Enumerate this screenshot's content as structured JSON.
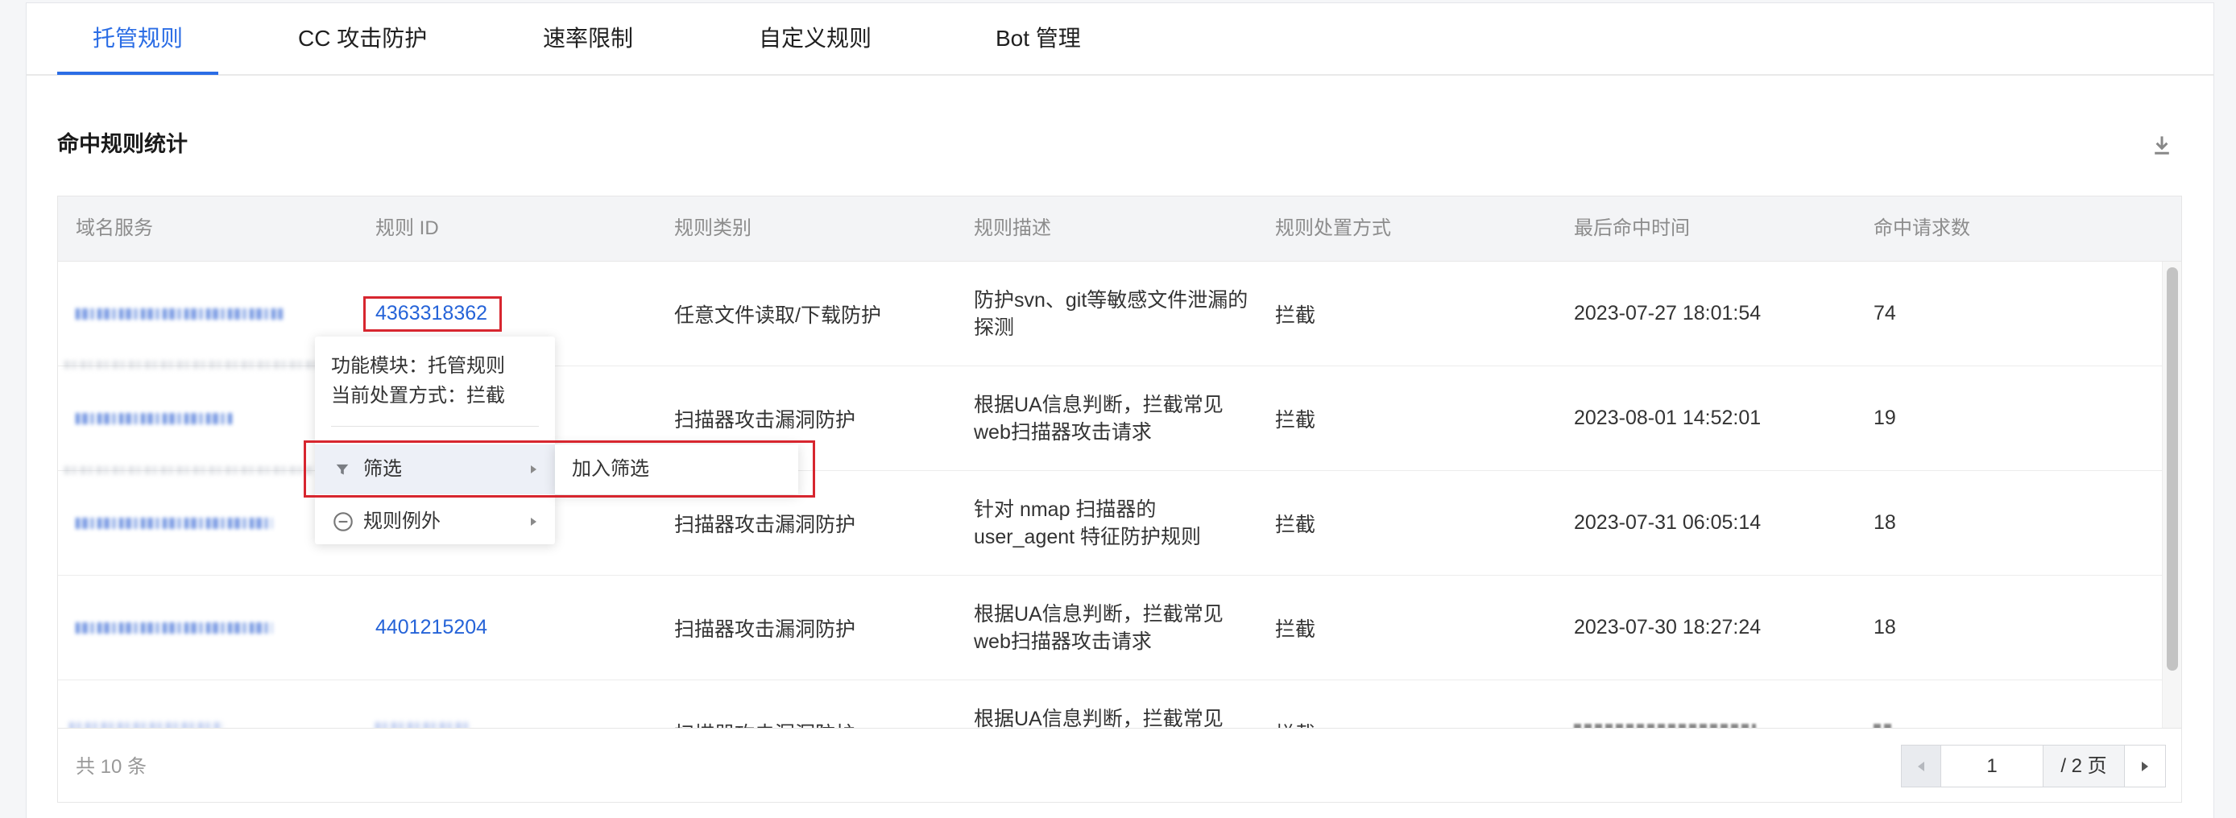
{
  "tabs": [
    {
      "label": "托管规则",
      "active": true
    },
    {
      "label": "CC 攻击防护",
      "active": false
    },
    {
      "label": "速率限制",
      "active": false
    },
    {
      "label": "自定义规则",
      "active": false
    },
    {
      "label": "Bot 管理",
      "active": false
    }
  ],
  "section": {
    "title": "命中规则统计"
  },
  "table": {
    "columns": [
      "域名服务",
      "规则 ID",
      "规则类别",
      "规则描述",
      "规则处置方式",
      "最后命中时间",
      "命中请求数"
    ],
    "rows": [
      {
        "rule_id": "4363318362",
        "category": "任意文件读取/下载防护",
        "description": [
          "防护svn、git等敏感文件泄漏的",
          "探测"
        ],
        "action": "拦截",
        "last_hit": "2023-07-27 18:01:54",
        "hits": "74"
      },
      {
        "category": "扫描器攻击漏洞防护",
        "description": [
          "根据UA信息判断，拦截常见",
          "web扫描器攻击请求"
        ],
        "action": "拦截",
        "last_hit": "2023-08-01 14:52:01",
        "hits": "19"
      },
      {
        "category": "扫描器攻击漏洞防护",
        "description": [
          "针对 nmap 扫描器的",
          "user_agent 特征防护规则"
        ],
        "action": "拦截",
        "last_hit": "2023-07-31 06:05:14",
        "hits": "18"
      },
      {
        "rule_id": "4401215204",
        "category": "扫描器攻击漏洞防护",
        "description": [
          "根据UA信息判断，拦截常见",
          "web扫描器攻击请求"
        ],
        "action": "拦截",
        "last_hit": "2023-07-30 18:27:24",
        "hits": "18"
      },
      {
        "category": "扫描器攻击漏洞防护",
        "description": [
          "根据UA信息判断，拦截常见"
        ],
        "action": "拦截"
      }
    ]
  },
  "context_menu": {
    "module_line": "功能模块：托管规则",
    "action_line": "当前处置方式：拦截",
    "items": [
      {
        "label": "筛选",
        "icon": "filter-icon",
        "highlighted": true
      },
      {
        "label": "规则例外",
        "icon": "minus-circle-icon",
        "highlighted": false
      }
    ],
    "submenu": [
      {
        "label": "加入筛选"
      }
    ]
  },
  "pagination": {
    "total": "共 10 条",
    "current_page": "1",
    "page_count": "/ 2 页"
  },
  "icons": {
    "export": "download-icon",
    "submenu_arrow": "caret-right-icon",
    "prev_page": "caret-left-icon",
    "next_page": "caret-right-icon"
  },
  "colors": {
    "accent": "#2b6de5",
    "link": "#2563d8",
    "annotation": "#d7262f",
    "header_bg": "#f3f4f6",
    "menu_highlight": "#edf0f7"
  }
}
